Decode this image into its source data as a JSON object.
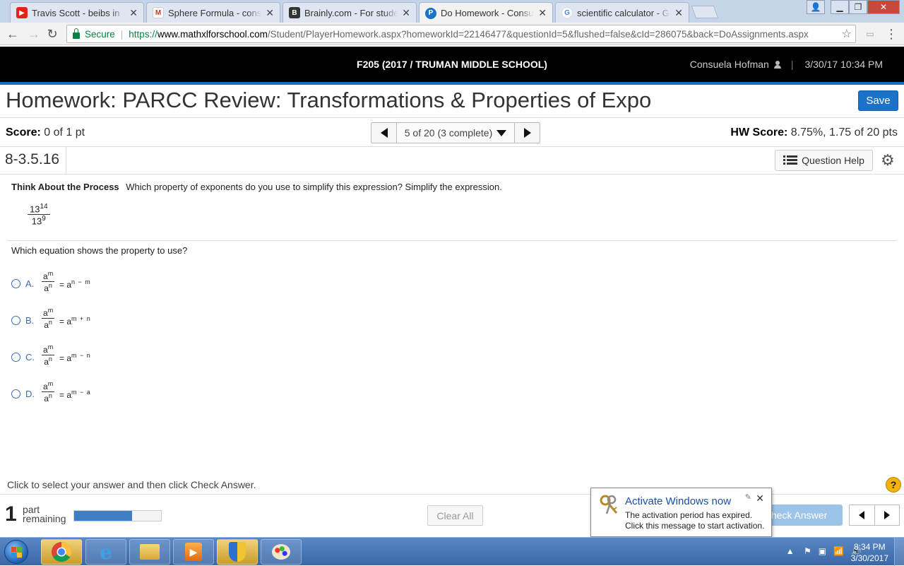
{
  "browser": {
    "tabs": [
      {
        "title": "Travis Scott - beibs in",
        "favicon": "youtube-icon",
        "color": "#e62117"
      },
      {
        "title": "Sphere Formula - consue",
        "favicon": "gmail-icon",
        "color": "#d93025"
      },
      {
        "title": "Brainly.com - For student",
        "favicon": "brainly-icon",
        "color": "#333333"
      },
      {
        "title": "Do Homework - Consuel",
        "favicon": "pearson-icon",
        "color": "#1a73c8"
      },
      {
        "title": "scientific calculator - Goo",
        "favicon": "google-icon",
        "color": "#4285f4"
      }
    ],
    "secure_label": "Secure",
    "url_scheme": "https://",
    "url_host": "www.mathxlforschool.com",
    "url_path": "/Student/PlayerHomework.aspx?homeworkId=22146477&questionId=5&flushed=false&cId=286075&back=DoAssignments.aspx"
  },
  "header": {
    "course": "F205 (2017 / TRUMAN MIDDLE SCHOOL)",
    "user": "Consuela Hofman",
    "datetime": "3/30/17 10:34 PM",
    "homework_title": "Homework: PARCC Review: Transformations & Properties of Expo",
    "save_label": "Save"
  },
  "scorebar": {
    "score_label": "Score:",
    "score_value": "0 of 1 pt",
    "question_nav": "5 of 20 (3 complete)",
    "hw_score_label": "HW Score:",
    "hw_score_value": "8.75%, 1.75 of 20 pts"
  },
  "question": {
    "id": "8-3.5.16",
    "help_label": "Question Help",
    "prompt_bold": "Think About the Process",
    "prompt_text": "Which property of exponents do you use to simplify this expression? Simplify the expression.",
    "expr_num_base": "13",
    "expr_num_exp": "14",
    "expr_den_base": "13",
    "expr_den_exp": "9",
    "sub_question": "Which equation shows the property to use?",
    "choices": [
      {
        "letter": "A.",
        "num_base": "a",
        "num_exp": "m",
        "den_base": "a",
        "den_exp": "n",
        "rhs_base": "= a",
        "rhs_exp": "n − m"
      },
      {
        "letter": "B.",
        "num_base": "a",
        "num_exp": "m",
        "den_base": "a",
        "den_exp": "n",
        "rhs_base": "= a",
        "rhs_exp": "m + n"
      },
      {
        "letter": "C.",
        "num_base": "a",
        "num_exp": "m",
        "den_base": "a",
        "den_exp": "n",
        "rhs_base": "= a",
        "rhs_exp": "m − n"
      },
      {
        "letter": "D.",
        "num_base": "a",
        "num_exp": "m",
        "den_base": "a",
        "den_exp": "n",
        "rhs_base": "= a",
        "rhs_exp": "m − a"
      }
    ]
  },
  "footer": {
    "instruction": "Click to select your answer and then click Check Answer.",
    "parts_count": "1",
    "parts_label_1": "part",
    "parts_label_2": "remaining",
    "progress_fraction": 0.67,
    "clear_label": "Clear All",
    "check_label": "Check Answer"
  },
  "activation": {
    "title": "Activate Windows now",
    "line1": "The activation period has expired.",
    "line2": "Click this message to start activation."
  },
  "taskbar": {
    "time": "8:34 PM",
    "date": "3/30/2017"
  },
  "colors": {
    "accent": "#1a73c8",
    "topbar": "#000000",
    "choice": "#3a6ab5"
  }
}
